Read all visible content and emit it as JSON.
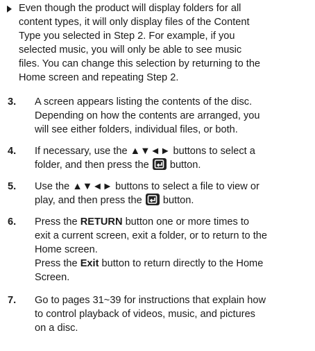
{
  "note": {
    "lines": [
      "Even though the product will display folders for all",
      "content types, it will only display files of the Content",
      "Type you selected in Step 2. For example, if you",
      "selected music, you will only be able to see music",
      "files. You can change this selection by returning to the",
      "Home screen and repeating Step 2."
    ]
  },
  "steps": [
    {
      "number": "3.",
      "lines": [
        "A screen appears listing the contents of the disc.",
        "Depending on how the contents are arranged, you",
        "will see either folders, individual files, or both."
      ]
    },
    {
      "number": "4.",
      "line1": "If necessary, use the ▲▼◄► buttons to select a",
      "line2_before": "folder, and then press the",
      "line2_after": "button."
    },
    {
      "number": "5.",
      "line1": "Use the ▲▼◄► buttons to select a file to view or",
      "line2_before": "play, and then press the",
      "line2_after": "button."
    },
    {
      "number": "6.",
      "l1_before": "Press the ",
      "l1_bold": "RETURN",
      "l1_after": " button one or more times to",
      "l2": "exit a current screen, exit a folder, or to return to the",
      "l3": "Home screen.",
      "l4_before": "Press the ",
      "l4_bold": "Exit",
      "l4_after": " button to return directly to the Home",
      "l5": "Screen."
    },
    {
      "number": "7.",
      "lines": [
        "Go to pages 31~39 for instructions that explain how",
        "to control playback of videos, music, and pictures",
        "on a disc."
      ]
    }
  ],
  "icons": {
    "note_marker": "right-triangle-bullet-icon",
    "enter_button": "enter-button-icon"
  },
  "colors": {
    "text": "#1a1a1a",
    "icon_bg": "#222222"
  }
}
